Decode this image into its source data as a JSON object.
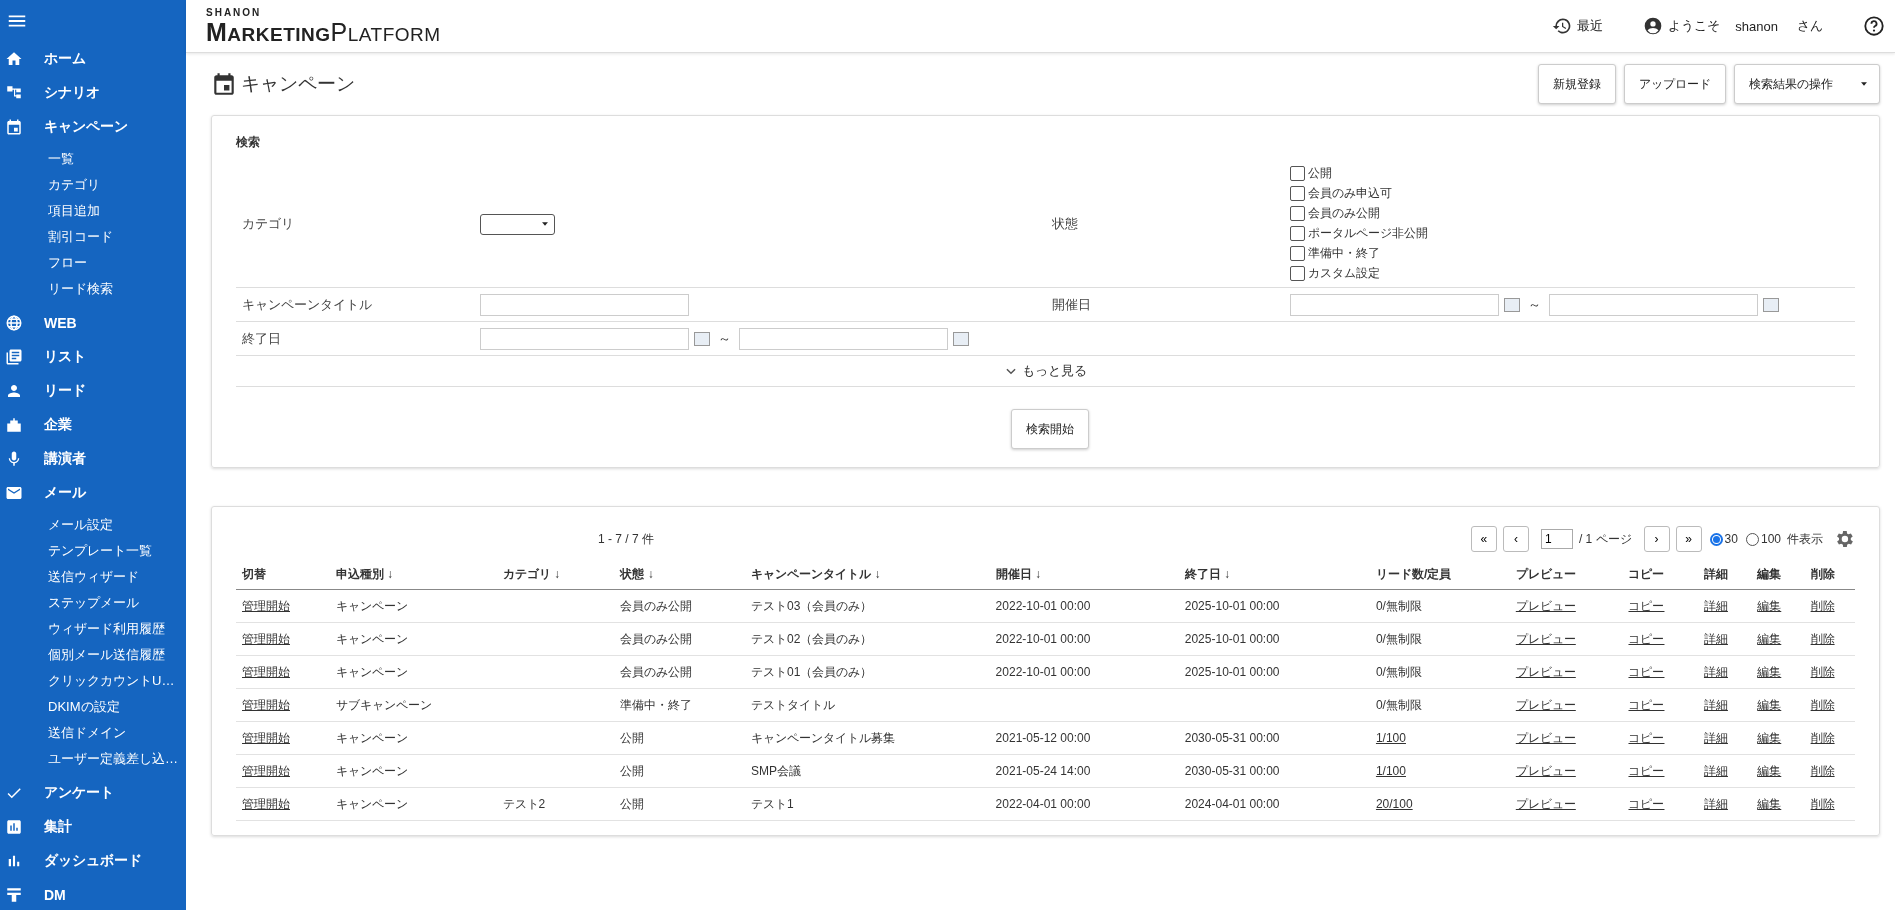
{
  "sidebar": {
    "items": [
      {
        "label": "ホーム"
      },
      {
        "label": "シナリオ"
      },
      {
        "label": "キャンペーン",
        "children": [
          {
            "label": "一覧"
          },
          {
            "label": "カテゴリ"
          },
          {
            "label": "項目追加"
          },
          {
            "label": "割引コード"
          },
          {
            "label": "フロー"
          },
          {
            "label": "リード検索"
          }
        ]
      },
      {
        "label": "WEB"
      },
      {
        "label": "リスト"
      },
      {
        "label": "リード"
      },
      {
        "label": "企業"
      },
      {
        "label": "講演者"
      },
      {
        "label": "メール",
        "children": [
          {
            "label": "メール設定"
          },
          {
            "label": "テンプレート一覧"
          },
          {
            "label": "送信ウィザード"
          },
          {
            "label": "ステップメール"
          },
          {
            "label": "ウィザード利用履歴"
          },
          {
            "label": "個別メール送信履歴"
          },
          {
            "label": "クリックカウントU…"
          },
          {
            "label": "DKIMの設定"
          },
          {
            "label": "送信ドメイン"
          },
          {
            "label": "ユーザー定義差し込…"
          }
        ]
      },
      {
        "label": "アンケート"
      },
      {
        "label": "集計"
      },
      {
        "label": "ダッシュボード"
      },
      {
        "label": "DM"
      }
    ]
  },
  "header": {
    "logo_top": "SHANON",
    "logo_words": [
      "MARKETING",
      "PLATFORM"
    ],
    "recent": "最近",
    "welcome": "ようこそ",
    "user": "shanon",
    "honorific": "さん"
  },
  "page": {
    "title": "キャンペーン",
    "buttons": [
      "新規登録",
      "アップロード"
    ],
    "actions_select": "検索結果の操作"
  },
  "search": {
    "heading": "検索",
    "category_label": "カテゴリ",
    "status_label": "状態",
    "statuses": [
      {
        "label": "公開",
        "checked": false
      },
      {
        "label": "会員のみ申込可",
        "checked": false
      },
      {
        "label": "会員のみ公開",
        "checked": false
      },
      {
        "label": "ポータルページ非公開",
        "checked": false
      },
      {
        "label": "準備中・終了",
        "checked": false
      },
      {
        "label": "カスタム設定",
        "checked": false
      }
    ],
    "title_label": "キャンペーンタイトル",
    "start_label": "開催日",
    "end_label": "終了日",
    "range_sep": "～",
    "more": "もっと見る",
    "submit": "検索開始"
  },
  "results": {
    "count": "1 - 7 / 7 件",
    "pager": {
      "first": "«",
      "prev": "‹",
      "page": "1",
      "total": "/ 1 ページ",
      "next": "›",
      "last": "»"
    },
    "per_page": [
      {
        "label": "30",
        "selected": true
      },
      {
        "label": "100",
        "selected": false
      }
    ],
    "per_page_suffix": "件表示",
    "table": {
      "columns": [
        "切替",
        "申込種別 ↓",
        "カテゴリ ↓",
        "状態 ↓",
        "キャンペーンタイトル ↓",
        "開催日 ↓",
        "終了日 ↓",
        "リード数/定員",
        "プレビュー",
        "コピー",
        "詳細",
        "編集",
        "削除"
      ],
      "rows": [
        [
          {
            "text": "管理開始",
            "link": true
          },
          {
            "text": "キャンペーン"
          },
          {},
          {
            "text": "会員のみ公開"
          },
          {
            "text": "テスト03（会員のみ）"
          },
          {
            "text": "2022-10-01 00:00"
          },
          {
            "text": "2025-10-01 00:00"
          },
          {
            "text": "0/無制限"
          },
          {
            "text": "プレビュー",
            "link": true
          },
          {
            "text": "コピー",
            "link": true
          },
          {
            "text": "詳細",
            "link": true
          },
          {
            "text": "編集",
            "link": true
          },
          {
            "text": "削除",
            "link": true
          }
        ],
        [
          {
            "text": "管理開始",
            "link": true
          },
          {
            "text": "キャンペーン"
          },
          {},
          {
            "text": "会員のみ公開"
          },
          {
            "text": "テスト02（会員のみ）"
          },
          {
            "text": "2022-10-01 00:00"
          },
          {
            "text": "2025-10-01 00:00"
          },
          {
            "text": "0/無制限"
          },
          {
            "text": "プレビュー",
            "link": true
          },
          {
            "text": "コピー",
            "link": true
          },
          {
            "text": "詳細",
            "link": true
          },
          {
            "text": "編集",
            "link": true
          },
          {
            "text": "削除",
            "link": true
          }
        ],
        [
          {
            "text": "管理開始",
            "link": true
          },
          {
            "text": "キャンペーン"
          },
          {},
          {
            "text": "会員のみ公開"
          },
          {
            "text": "テスト01（会員のみ）"
          },
          {
            "text": "2022-10-01 00:00"
          },
          {
            "text": "2025-10-01 00:00"
          },
          {
            "text": "0/無制限"
          },
          {
            "text": "プレビュー",
            "link": true
          },
          {
            "text": "コピー",
            "link": true
          },
          {
            "text": "詳細",
            "link": true
          },
          {
            "text": "編集",
            "link": true
          },
          {
            "text": "削除",
            "link": true
          }
        ],
        [
          {
            "text": "管理開始",
            "link": true
          },
          {
            "text": "サブキャンペーン"
          },
          {},
          {
            "text": "準備中・終了"
          },
          {
            "text": "テストタイトル"
          },
          {},
          {},
          {
            "text": "0/無制限"
          },
          {
            "text": "プレビュー",
            "link": true
          },
          {
            "text": "コピー",
            "link": true
          },
          {
            "text": "詳細",
            "link": true
          },
          {
            "text": "編集",
            "link": true
          },
          {
            "text": "削除",
            "link": true
          }
        ],
        [
          {
            "text": "管理開始",
            "link": true
          },
          {
            "text": "キャンペーン"
          },
          {},
          {
            "text": "公開"
          },
          {
            "text": "キャンペーンタイトル募集"
          },
          {
            "text": "2021-05-12 00:00"
          },
          {
            "text": "2030-05-31 00:00"
          },
          {
            "text": "1/100",
            "link": true
          },
          {
            "text": "プレビュー",
            "link": true
          },
          {
            "text": "コピー",
            "link": true
          },
          {
            "text": "詳細",
            "link": true
          },
          {
            "text": "編集",
            "link": true
          },
          {
            "text": "削除",
            "link": true
          }
        ],
        [
          {
            "text": "管理開始",
            "link": true
          },
          {
            "text": "キャンペーン"
          },
          {},
          {
            "text": "公開"
          },
          {
            "text": "SMP会議"
          },
          {
            "text": "2021-05-24 14:00"
          },
          {
            "text": "2030-05-31 00:00"
          },
          {
            "text": "1/100",
            "link": true
          },
          {
            "text": "プレビュー",
            "link": true
          },
          {
            "text": "コピー",
            "link": true
          },
          {
            "text": "詳細",
            "link": true
          },
          {
            "text": "編集",
            "link": true
          },
          {
            "text": "削除",
            "link": true
          }
        ],
        [
          {
            "text": "管理開始",
            "link": true
          },
          {
            "text": "キャンペーン"
          },
          {
            "text": "テスト2"
          },
          {
            "text": "公開"
          },
          {
            "text": "テスト1"
          },
          {
            "text": "2022-04-01 00:00"
          },
          {
            "text": "2024-04-01 00:00"
          },
          {
            "text": "20/100",
            "link": true
          },
          {
            "text": "プレビュー",
            "link": true
          },
          {
            "text": "コピー",
            "link": true
          },
          {
            "text": "詳細",
            "link": true
          },
          {
            "text": "編集",
            "link": true
          },
          {
            "text": "削除",
            "link": true
          }
        ]
      ]
    }
  }
}
